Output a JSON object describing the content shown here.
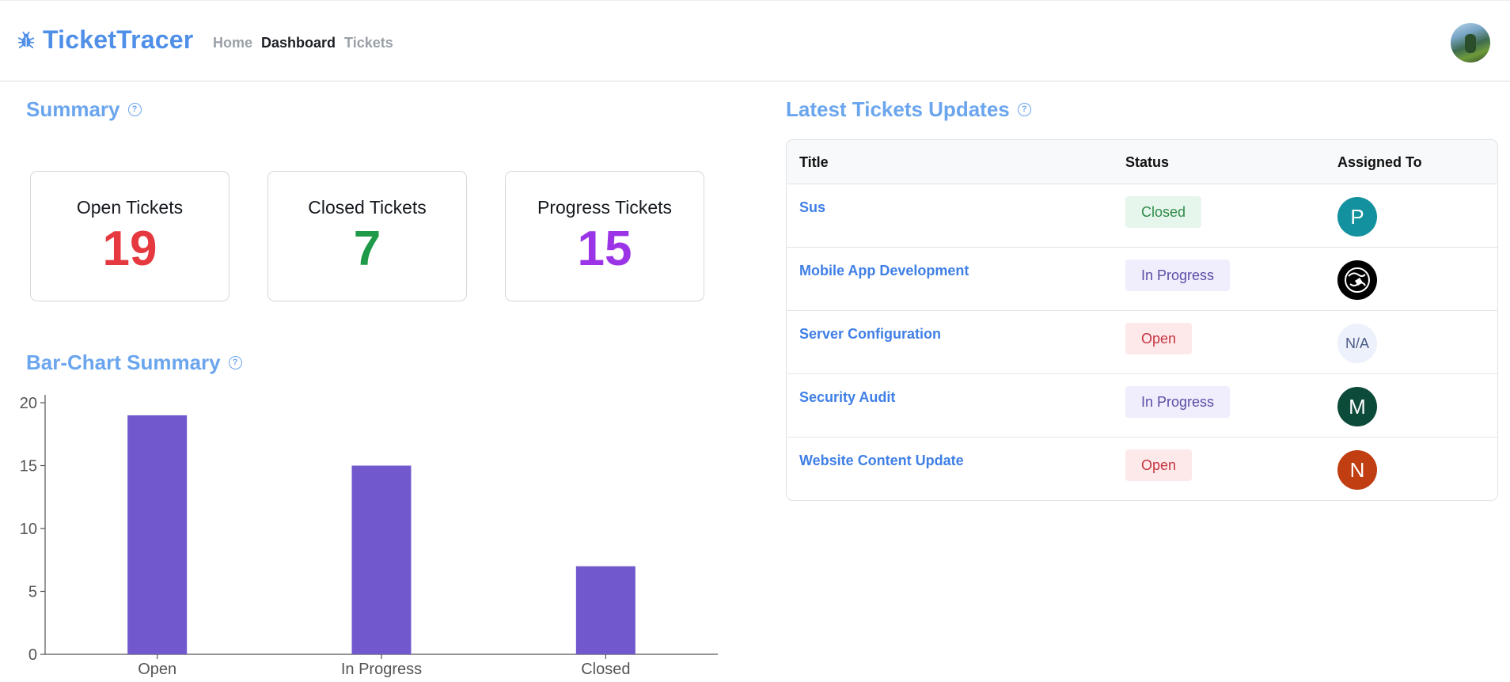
{
  "header": {
    "brand": "TicketTracer",
    "nav": [
      {
        "label": "Home",
        "active": false
      },
      {
        "label": "Dashboard",
        "active": true
      },
      {
        "label": "Tickets",
        "active": false
      }
    ],
    "brand_icon": "bug-icon",
    "avatar_icon": "user-avatar"
  },
  "summary": {
    "title": "Summary",
    "cards": [
      {
        "label": "Open Tickets",
        "value": "19",
        "color": "#e5383f"
      },
      {
        "label": "Closed Tickets",
        "value": "7",
        "color": "#1f9a48"
      },
      {
        "label": "Progress Tickets",
        "value": "15",
        "color": "#9a34e6"
      }
    ]
  },
  "bar_section": {
    "title": "Bar-Chart Summary"
  },
  "chart_data": {
    "type": "bar",
    "categories": [
      "Open",
      "In Progress",
      "Closed"
    ],
    "values": [
      19,
      15,
      7
    ],
    "ylim": [
      0,
      20
    ],
    "yticks": [
      0,
      5,
      10,
      15,
      20
    ],
    "bar_color": "#7158cd",
    "grid": false,
    "title": "",
    "xlabel": "",
    "ylabel": ""
  },
  "latest": {
    "title": "Latest Tickets Updates",
    "columns": [
      "Title",
      "Status",
      "Assigned To"
    ],
    "rows": [
      {
        "title": "Sus",
        "status": "Closed",
        "status_type": "closed",
        "assignee": "P",
        "avatar_style": "teal"
      },
      {
        "title": "Mobile App Development",
        "status": "In Progress",
        "status_type": "progress",
        "assignee": "",
        "avatar_style": "black"
      },
      {
        "title": "Server Configuration",
        "status": "Open",
        "status_type": "open",
        "assignee": "N/A",
        "avatar_style": "na"
      },
      {
        "title": "Security Audit",
        "status": "In Progress",
        "status_type": "progress",
        "assignee": "M",
        "avatar_style": "dgreen"
      },
      {
        "title": "Website Content Update",
        "status": "Open",
        "status_type": "open",
        "assignee": "N",
        "avatar_style": "rust"
      }
    ]
  }
}
